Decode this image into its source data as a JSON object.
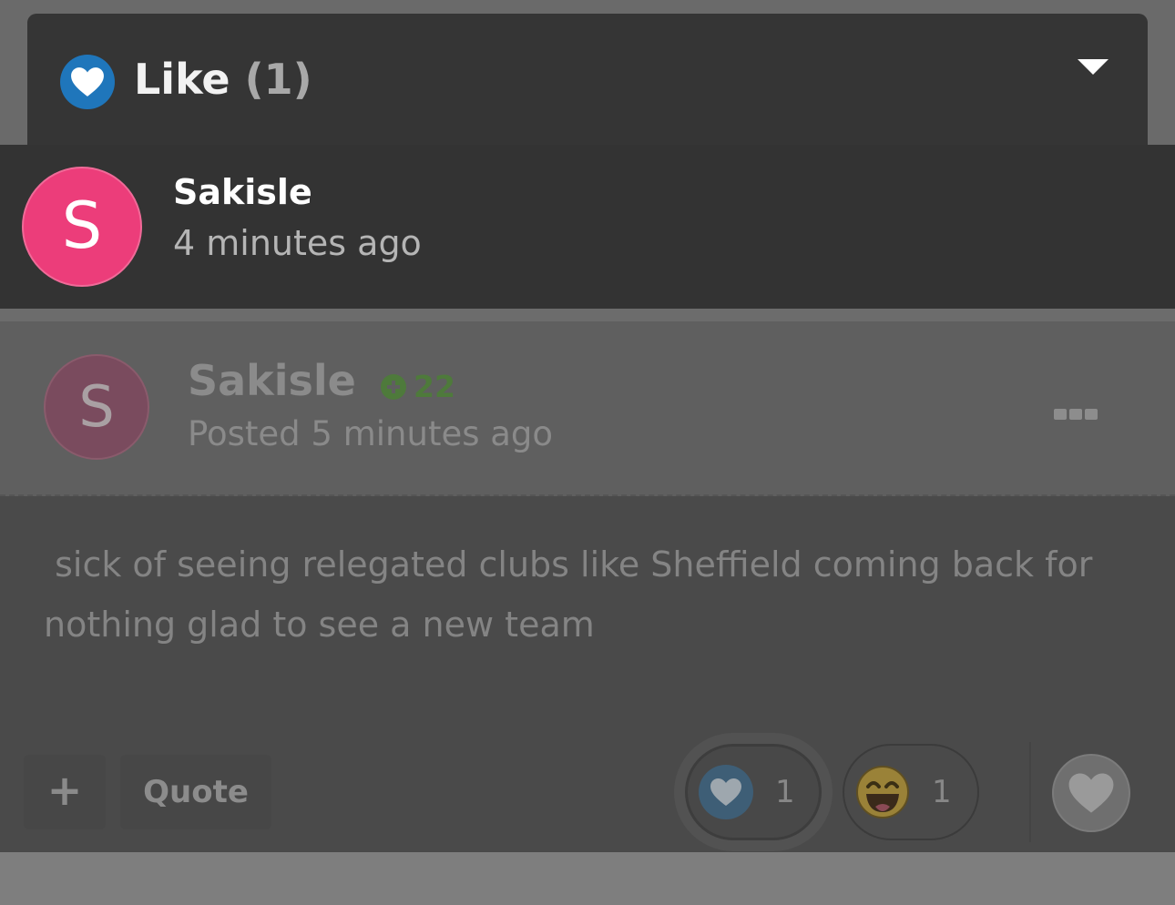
{
  "popup": {
    "title": "Like",
    "count": "(1)",
    "users": [
      {
        "initial": "S",
        "name": "Sakisle",
        "time": "4 minutes ago"
      }
    ]
  },
  "post": {
    "author": {
      "initial": "S",
      "name": "Sakisle"
    },
    "reputation": "22",
    "posted": "Posted 5 minutes ago",
    "content": " sick of seeing relegated clubs like Sheffield coming back for\nnothing glad to see a new team",
    "actions": {
      "plus": "+",
      "quote": "Quote"
    },
    "reactions": [
      {
        "icon": "heart-icon",
        "count": "1"
      },
      {
        "icon": "laugh-icon",
        "count": "1"
      }
    ]
  },
  "colors": {
    "like_blue": "#1f76bb",
    "avatar_pink": "#ec3d7a",
    "reputation_green": "#4e7a3b"
  }
}
